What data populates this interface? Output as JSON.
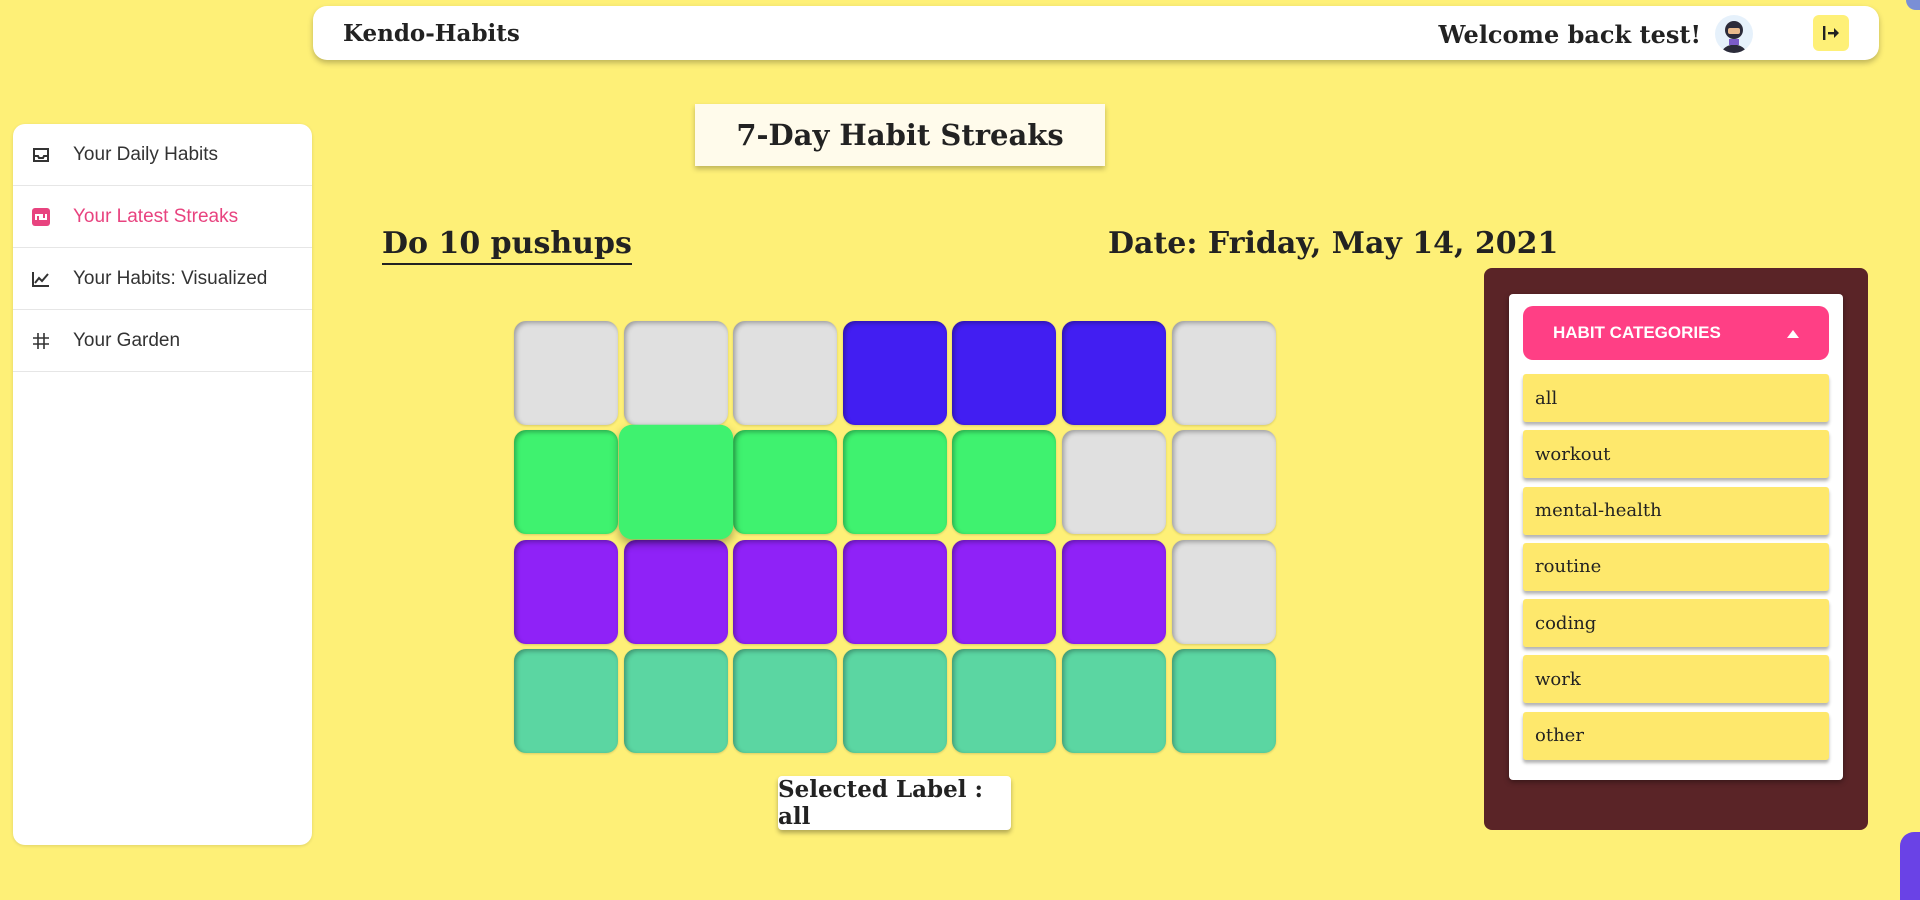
{
  "header": {
    "brand": "Kendo-Habits",
    "welcome": "Welcome back test!"
  },
  "sidebar": {
    "items": [
      {
        "label": "Your Daily Habits",
        "icon": "inbox-icon"
      },
      {
        "label": "Your Latest Streaks",
        "icon": "streak-icon",
        "active": true
      },
      {
        "label": "Your Habits: Visualized",
        "icon": "line-chart-icon"
      },
      {
        "label": "Your Garden",
        "icon": "grid-icon"
      }
    ]
  },
  "main": {
    "title": "7-Day Habit Streaks",
    "habit_name": "Do 10 pushups",
    "date_label": "Date: Friday, May 14, 2021",
    "selected_label": "Selected Label : all",
    "streak_rows": [
      {
        "color": "#421ef2",
        "done": [
          false,
          false,
          false,
          true,
          true,
          true,
          false
        ]
      },
      {
        "color": "#3ff26f",
        "done": [
          true,
          true,
          true,
          true,
          true,
          false,
          false
        ]
      },
      {
        "color": "#8f22f7",
        "done": [
          true,
          true,
          true,
          true,
          true,
          true,
          false
        ]
      },
      {
        "color": "#5bd6a2",
        "done": [
          true,
          true,
          true,
          true,
          true,
          true,
          true
        ]
      }
    ],
    "empty_color": "#e0e0e0"
  },
  "categories": {
    "header": "HABIT CATEGORIES",
    "items": [
      "all",
      "workout",
      "mental-health",
      "routine",
      "coding",
      "work",
      "other"
    ]
  },
  "colors": {
    "background": "#fef077",
    "accent": "#e8437f",
    "panel": "#5a2427",
    "category_header": "#ff3f85"
  }
}
